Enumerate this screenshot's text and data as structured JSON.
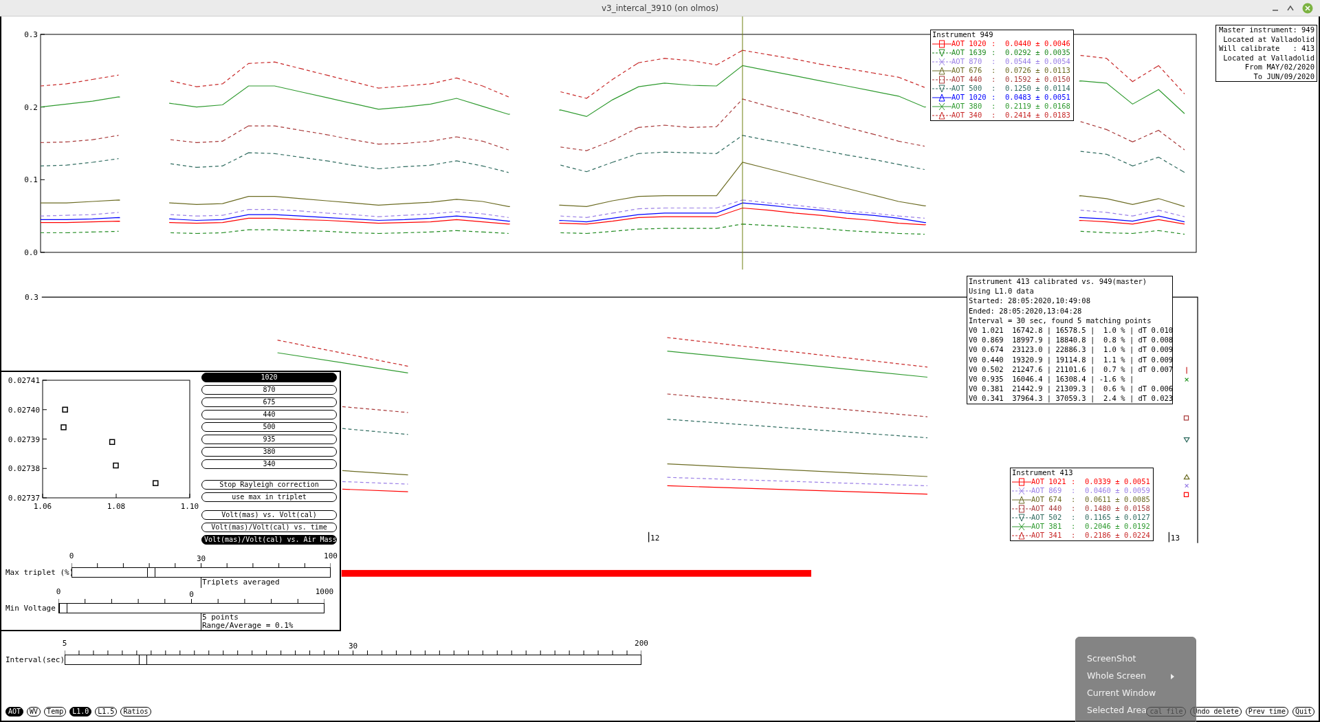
{
  "window": {
    "title": "v3_intercal_3910 (on olmos)"
  },
  "top_chart": {
    "chart_data": {
      "type": "line",
      "categories": [
        null,
        null,
        null,
        null,
        null,
        null,
        null,
        null,
        null,
        null,
        null,
        null,
        null,
        null,
        null,
        null,
        null,
        null,
        null,
        null,
        null,
        null,
        null,
        null,
        null,
        null,
        null,
        null,
        null,
        null,
        null,
        null,
        null,
        null,
        null,
        null,
        null,
        null,
        null,
        null,
        null,
        null,
        null,
        null,
        null
      ],
      "ylim": [
        0,
        0.3
      ],
      "yticks": [
        {
          "value": 0,
          "label": "0.0"
        },
        {
          "value": 0.1,
          "label": "0.1"
        },
        {
          "value": 0.2,
          "label": "0.2"
        },
        {
          "value": 0.3,
          "label": "0.3"
        }
      ],
      "series": [
        {
          "name": "AOT 1020",
          "color": "#ff0000",
          "line_style": "solid",
          "values": [
            0.041,
            0.041,
            0.042,
            0.043,
            null,
            0.041,
            0.04,
            0.041,
            0.047,
            0.047,
            0.045,
            0.044,
            0.042,
            0.04,
            0.041,
            0.042,
            0.045,
            0.042,
            0.039,
            null,
            0.04,
            0.039,
            0.043,
            0.048,
            0.049,
            0.049,
            0.049,
            0.061,
            0.058,
            0.054,
            0.051,
            0.047,
            0.044,
            0.04,
            0.038,
            null,
            null,
            null,
            null,
            null,
            0.044,
            0.042,
            0.039,
            0.045,
            0.039
          ]
        },
        {
          "name": "AOT 1639",
          "color": "#1f8a1f",
          "line_style": "dashed",
          "values": [
            0.027,
            0.027,
            0.028,
            0.029,
            null,
            0.027,
            0.026,
            0.027,
            0.031,
            0.031,
            0.03,
            0.029,
            0.027,
            0.026,
            0.027,
            0.028,
            0.03,
            0.028,
            0.026,
            null,
            0.027,
            0.026,
            0.029,
            0.032,
            0.033,
            0.033,
            0.033,
            0.039,
            0.037,
            0.035,
            0.033,
            0.03,
            0.028,
            0.026,
            0.025,
            null,
            null,
            null,
            null,
            null,
            0.029,
            0.027,
            0.026,
            0.03,
            0.025
          ]
        },
        {
          "name": "AOT 870",
          "color": "#9a7fe6",
          "line_style": "dashed",
          "values": [
            0.05,
            0.051,
            0.052,
            0.055,
            null,
            0.052,
            0.05,
            0.051,
            0.059,
            0.059,
            0.057,
            0.054,
            0.052,
            0.049,
            0.051,
            0.053,
            0.056,
            0.053,
            0.048,
            null,
            0.05,
            0.048,
            0.054,
            0.06,
            0.061,
            0.061,
            0.061,
            0.072,
            0.068,
            0.065,
            0.061,
            0.057,
            0.054,
            0.05,
            0.047,
            null,
            null,
            null,
            null,
            null,
            0.058,
            0.055,
            0.05,
            0.058,
            0.049
          ]
        },
        {
          "name": "AOT 676",
          "color": "#6b6b22",
          "line_style": "solid",
          "values": [
            0.068,
            0.068,
            0.07,
            0.072,
            null,
            0.068,
            0.066,
            0.067,
            0.077,
            0.077,
            0.074,
            0.071,
            0.068,
            0.065,
            0.067,
            0.069,
            0.073,
            0.07,
            0.063,
            null,
            0.065,
            0.063,
            0.071,
            0.077,
            0.078,
            0.078,
            0.078,
            0.124,
            0.115,
            0.106,
            0.097,
            0.088,
            0.079,
            0.07,
            0.064,
            null,
            null,
            null,
            null,
            null,
            0.078,
            0.074,
            0.066,
            0.074,
            0.063
          ]
        },
        {
          "name": "AOT 440",
          "color": "#a83838",
          "line_style": "dashed",
          "values": [
            0.151,
            0.152,
            0.155,
            0.161,
            null,
            0.155,
            0.151,
            0.153,
            0.174,
            0.174,
            0.168,
            0.162,
            0.155,
            0.149,
            0.15,
            0.153,
            0.159,
            0.153,
            0.141,
            null,
            0.145,
            0.14,
            0.154,
            0.172,
            0.175,
            0.172,
            0.173,
            0.211,
            0.201,
            0.192,
            0.182,
            0.172,
            0.163,
            0.153,
            0.146,
            null,
            null,
            null,
            null,
            null,
            0.18,
            0.169,
            0.152,
            0.168,
            0.141
          ]
        },
        {
          "name": "AOT 500",
          "color": "#2f6b5f",
          "line_style": "dashed",
          "values": [
            0.119,
            0.12,
            0.124,
            0.129,
            null,
            0.122,
            0.117,
            0.119,
            0.137,
            0.136,
            0.131,
            0.126,
            0.12,
            0.115,
            0.118,
            0.12,
            0.126,
            0.119,
            0.11,
            null,
            0.12,
            0.111,
            0.124,
            0.136,
            0.138,
            0.137,
            0.136,
            0.161,
            0.154,
            0.148,
            0.141,
            0.134,
            0.128,
            0.121,
            0.114,
            null,
            null,
            null,
            null,
            null,
            0.139,
            0.135,
            0.119,
            0.131,
            0.11
          ]
        },
        {
          "name": "AOT 1020",
          "color": "#0000ff",
          "line_style": "solid",
          "values": [
            0.045,
            0.045,
            0.046,
            0.048,
            null,
            0.046,
            0.044,
            0.045,
            0.052,
            0.052,
            0.05,
            0.048,
            0.046,
            0.044,
            0.045,
            0.047,
            0.05,
            0.047,
            0.043,
            null,
            0.044,
            0.042,
            0.047,
            0.052,
            0.054,
            0.054,
            0.054,
            0.068,
            0.065,
            0.061,
            0.058,
            0.054,
            0.051,
            0.047,
            0.041,
            null,
            null,
            null,
            null,
            null,
            0.048,
            0.046,
            0.043,
            0.05,
            0.042
          ]
        },
        {
          "name": "AOT 380",
          "color": "#2e9a2e",
          "line_style": "solid",
          "values": [
            0.2,
            0.204,
            0.208,
            0.214,
            null,
            0.205,
            0.2,
            0.203,
            0.229,
            0.229,
            0.221,
            0.213,
            0.205,
            0.197,
            0.2,
            0.204,
            0.212,
            0.201,
            0.19,
            null,
            0.196,
            0.187,
            0.21,
            0.228,
            0.233,
            0.23,
            0.229,
            0.257,
            0.25,
            0.243,
            0.236,
            0.229,
            0.222,
            0.215,
            0.2,
            null,
            null,
            null,
            null,
            null,
            0.236,
            0.233,
            0.204,
            0.224,
            0.191
          ]
        },
        {
          "name": "AOT 340",
          "color": "#c82828",
          "line_style": "dashed",
          "values": [
            0.229,
            0.232,
            0.238,
            0.244,
            null,
            0.236,
            0.228,
            0.232,
            0.26,
            0.262,
            0.253,
            0.244,
            0.235,
            0.226,
            0.229,
            0.232,
            0.24,
            0.229,
            0.214,
            null,
            0.221,
            0.212,
            0.238,
            0.261,
            0.267,
            0.264,
            0.258,
            0.278,
            0.272,
            0.266,
            0.259,
            0.253,
            0.247,
            0.241,
            0.227,
            null,
            null,
            null,
            null,
            null,
            0.271,
            0.267,
            0.235,
            0.257,
            0.218
          ]
        }
      ]
    }
  },
  "legend_949": {
    "title": "Instrument 949",
    "entries": [
      {
        "sep": ":",
        "value": "0.0440 ± 0.0046",
        "kind": "square",
        "dashed": false
      },
      {
        "sep": ":",
        "value": "0.0292 ± 0.0035",
        "kind": "triangle-down",
        "dashed": true
      },
      {
        "sep": ":",
        "value": "0.0544 ± 0.0054",
        "kind": "cross",
        "dashed": true
      },
      {
        "sep": ":",
        "value": "0.0726 ± 0.0113",
        "kind": "triangle-up",
        "dashed": false
      },
      {
        "sep": ":",
        "value": "0.1592 ± 0.0150",
        "kind": "square",
        "dashed": true
      },
      {
        "sep": ":",
        "value": "0.1250 ± 0.0114",
        "kind": "triangle-down",
        "dashed": true
      },
      {
        "sep": ":",
        "value": "0.0483 ± 0.0051",
        "kind": "triangle-up",
        "dashed": false
      },
      {
        "sep": ":",
        "value": "0.2119 ± 0.0168",
        "kind": "cross",
        "dashed": false
      },
      {
        "sep": ":",
        "value": "0.2414 ± 0.0183",
        "kind": "triangle-up",
        "dashed": true
      }
    ]
  },
  "master_box": [
    "Master instrument: 949",
    "Located at Valladolid",
    "Will calibrate   : 413",
    "Located at Valladolid",
    "From MAY/02/2020",
    "To JUN/09/2020"
  ],
  "bottom_chart": {
    "ytick_label": "0.3",
    "xtick_labels": [
      "12",
      "13"
    ]
  },
  "info_box": [
    "Instrument 413 calibrated vs. 949(master)",
    "Using L1.0 data",
    "Started: 28:05:2020,10:49:08",
    "Ended: 28:05:2020,13:04:28",
    "Interval = 30 sec, found 5 matching points",
    "V0 1.021  16742.8 | 16578.5 |  1.0 % | dT 0.010",
    "V0 0.869  18997.9 | 18840.8 |  0.8 % | dT 0.008",
    "V0 0.674  23123.0 | 22886.3 |  1.0 % | dT 0.009",
    "V0 0.440  19320.9 | 19114.8 |  1.1 % | dT 0.009",
    "V0 0.502  21247.6 | 21101.6 |  0.7 % | dT 0.007",
    "V0 0.935  16046.4 | 16308.4 | -1.6 % |",
    "V0 0.381  21442.9 | 21309.3 |  0.6 % | dT 0.006",
    "V0 0.341  37964.3 | 37059.3 |  2.4 % | dT 0.023"
  ],
  "legend_413": {
    "title": "Instrument 413",
    "entries": [
      {
        "label": "AOT 1021",
        "sep": ":",
        "value": "0.0339 ± 0.0051",
        "color": "#ff0000",
        "kind": "square",
        "dashed": false
      },
      {
        "label": "AOT 869",
        "sep": ":",
        "value": "0.0460 ± 0.0059",
        "color": "#9a7fe6",
        "kind": "cross",
        "dashed": true
      },
      {
        "label": "AOT 674",
        "sep": ":",
        "value": "0.0611 ± 0.0085",
        "color": "#6b6b22",
        "kind": "triangle-up",
        "dashed": false
      },
      {
        "label": "AOT 440",
        "sep": ":",
        "value": "0.1480 ± 0.0158",
        "color": "#a83838",
        "kind": "square",
        "dashed": true
      },
      {
        "label": "AOT 502",
        "sep": ":",
        "value": "0.1165 ± 0.0127",
        "color": "#2f6b5f",
        "kind": "triangle-down",
        "dashed": true
      },
      {
        "label": "AOT 381",
        "sep": ":",
        "value": "0.2046 ± 0.0192",
        "color": "#2e9a2e",
        "kind": "cross",
        "dashed": false
      },
      {
        "label": "AOT 341",
        "sep": ":",
        "value": "0.2186 ± 0.0224",
        "color": "#c82828",
        "kind": "triangle-up",
        "dashed": true
      }
    ]
  },
  "panel": {
    "chart_data": {
      "type": "scatter",
      "x": [
        1.0661,
        1.0657,
        1.0789,
        1.0799,
        1.0907
      ],
      "values": [
        0.0274,
        0.027394,
        0.027389,
        0.027381,
        0.027375
      ],
      "xlim": [
        1.06,
        1.1
      ],
      "ylim": [
        0.02737,
        0.02741
      ],
      "xticks": [
        {
          "value": 1.06,
          "label": "1.06"
        },
        {
          "value": 1.08,
          "label": "1.08"
        },
        {
          "value": 1.1,
          "label": "1.10"
        }
      ],
      "yticks": [
        {
          "value": 0.02737,
          "label": "0.02737"
        },
        {
          "value": 0.02738,
          "label": "0.02738"
        },
        {
          "value": 0.02739,
          "label": "0.02739"
        },
        {
          "value": 0.0274,
          "label": "0.02740"
        },
        {
          "value": 0.02741,
          "label": "0.02741"
        }
      ]
    },
    "wavelength_buttons": [
      {
        "label": "1020",
        "selected": true
      },
      {
        "label": "870",
        "selected": false
      },
      {
        "label": "675",
        "selected": false
      },
      {
        "label": "440",
        "selected": false
      },
      {
        "label": "500",
        "selected": false
      },
      {
        "label": "935",
        "selected": false
      },
      {
        "label": "380",
        "selected": false
      },
      {
        "label": "340",
        "selected": false
      }
    ],
    "option_buttons": [
      {
        "label": "Stop Rayleigh correction"
      },
      {
        "label": "use max in triplet"
      }
    ],
    "plot_buttons": [
      {
        "label": "Volt(mas) vs. Volt(cal)",
        "selected": false
      },
      {
        "label": "Volt(mas)/Volt(cal) vs. time",
        "selected": false
      },
      {
        "label": "Volt(mas)/Volt(cal) vs. Air Mass",
        "selected": true
      }
    ],
    "sliders": [
      {
        "label": "Max triplet (%)",
        "min": "0",
        "mid": "30",
        "max": "100",
        "level": 0.3,
        "notes": [
          "Triplets averaged"
        ]
      },
      {
        "label": "Min Voltage",
        "min": "0",
        "mid": "0",
        "max": "1000",
        "level": 0.0,
        "notes": [
          "5 points",
          "Range/Average = 0.1%"
        ]
      }
    ]
  },
  "interval_slider": {
    "label": "Interval(sec)",
    "min": "5",
    "mid": "30",
    "max": "200",
    "level": 0.13
  },
  "mode_buttons": [
    {
      "label": "AOT",
      "selected": true
    },
    {
      "label": "WV",
      "selected": false
    },
    {
      "label": "Temp",
      "selected": false
    },
    {
      "label": "L1.0",
      "selected": true
    },
    {
      "label": "L1.5",
      "selected": false
    },
    {
      "label": "Ratios",
      "selected": false
    }
  ],
  "action_buttons": [
    {
      "label": "cal file"
    },
    {
      "label": "Undo delete"
    },
    {
      "label": "Prev time"
    },
    {
      "label": "Quit"
    }
  ],
  "context_menu": {
    "items": [
      {
        "label": "ScreenShot",
        "submenu": false
      },
      {
        "label": "Whole Screen",
        "submenu": true
      },
      {
        "label": "Current Window",
        "submenu": false
      },
      {
        "label": "Selected Area",
        "submenu": false
      }
    ]
  }
}
